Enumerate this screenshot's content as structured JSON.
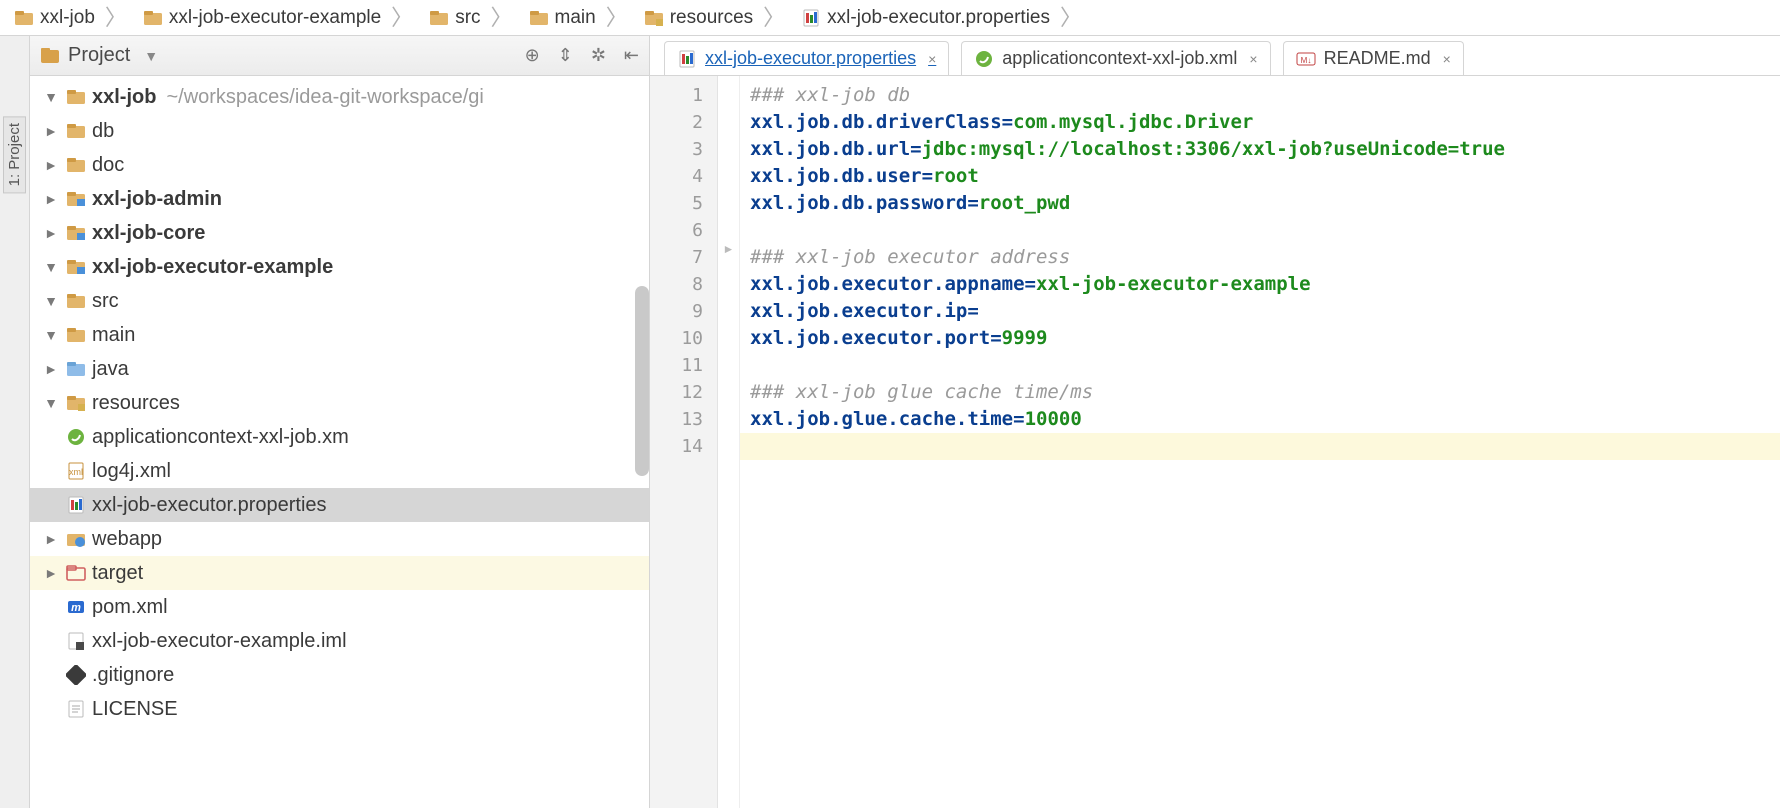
{
  "breadcrumbs": [
    {
      "label": "xxl-job",
      "icon": "folder"
    },
    {
      "label": "xxl-job-executor-example",
      "icon": "folder"
    },
    {
      "label": "src",
      "icon": "folder"
    },
    {
      "label": "main",
      "icon": "folder"
    },
    {
      "label": "resources",
      "icon": "res-folder"
    },
    {
      "label": "xxl-job-executor.properties",
      "icon": "props"
    }
  ],
  "vertical_tab": {
    "label": "1: Project"
  },
  "project_panel": {
    "title": "Project",
    "tree": [
      {
        "indent": 0,
        "arrow": "open",
        "icon": "folder",
        "label": "xxl-job",
        "bold": true,
        "hint": "~/workspaces/idea-git-workspace/gi"
      },
      {
        "indent": 1,
        "arrow": "closed",
        "icon": "folder",
        "label": "db"
      },
      {
        "indent": 1,
        "arrow": "closed",
        "icon": "folder",
        "label": "doc"
      },
      {
        "indent": 1,
        "arrow": "closed",
        "icon": "mod-folder",
        "label": "xxl-job-admin",
        "bold": true
      },
      {
        "indent": 1,
        "arrow": "closed",
        "icon": "mod-folder",
        "label": "xxl-job-core",
        "bold": true
      },
      {
        "indent": 1,
        "arrow": "open",
        "icon": "mod-folder",
        "label": "xxl-job-executor-example",
        "bold": true
      },
      {
        "indent": 2,
        "arrow": "open",
        "icon": "folder",
        "label": "src"
      },
      {
        "indent": 3,
        "arrow": "open",
        "icon": "folder",
        "label": "main"
      },
      {
        "indent": 4,
        "arrow": "closed",
        "icon": "src-folder",
        "label": "java"
      },
      {
        "indent": 4,
        "arrow": "open",
        "icon": "res-folder",
        "label": "resources"
      },
      {
        "indent": 5,
        "arrow": "none",
        "icon": "spring",
        "label": "applicationcontext-xxl-job.xm"
      },
      {
        "indent": 5,
        "arrow": "none",
        "icon": "xml",
        "label": "log4j.xml"
      },
      {
        "indent": 5,
        "arrow": "none",
        "icon": "props",
        "label": "xxl-job-executor.properties",
        "selected": true
      },
      {
        "indent": 4,
        "arrow": "closed",
        "icon": "web-folder",
        "label": "webapp"
      },
      {
        "indent": 2,
        "arrow": "closed",
        "icon": "excl-folder",
        "label": "target",
        "highlight": true
      },
      {
        "indent": 2,
        "arrow": "none",
        "icon": "maven",
        "label": "pom.xml"
      },
      {
        "indent": 2,
        "arrow": "none",
        "icon": "iml",
        "label": "xxl-job-executor-example.iml"
      },
      {
        "indent": 1,
        "arrow": "none",
        "icon": "git",
        "label": ".gitignore"
      },
      {
        "indent": 1,
        "arrow": "none",
        "icon": "text",
        "label": "LICENSE"
      }
    ]
  },
  "editor_tabs": [
    {
      "label": "xxl-job-executor.properties",
      "icon": "props",
      "active": true,
      "close": "×"
    },
    {
      "label": "applicationcontext-xxl-job.xml",
      "icon": "spring",
      "active": false,
      "close": "×"
    },
    {
      "label": "README.md",
      "icon": "md",
      "active": false,
      "close": "×"
    }
  ],
  "code_lines": [
    {
      "n": 1,
      "segments": [
        {
          "t": "### xxl-job db",
          "c": "comment"
        }
      ]
    },
    {
      "n": 2,
      "segments": [
        {
          "t": "xxl.job.db.driverClass",
          "c": "key"
        },
        {
          "t": "=",
          "c": "eq"
        },
        {
          "t": "com.mysql.jdbc.Driver",
          "c": "val"
        }
      ]
    },
    {
      "n": 3,
      "segments": [
        {
          "t": "xxl.job.db.url",
          "c": "key"
        },
        {
          "t": "=",
          "c": "eq"
        },
        {
          "t": "jdbc:mysql://localhost:3306/xxl-job?useUnicode=true",
          "c": "val"
        }
      ]
    },
    {
      "n": 4,
      "segments": [
        {
          "t": "xxl.job.db.user",
          "c": "key"
        },
        {
          "t": "=",
          "c": "eq"
        },
        {
          "t": "root",
          "c": "val"
        }
      ]
    },
    {
      "n": 5,
      "segments": [
        {
          "t": "xxl.job.db.password",
          "c": "key"
        },
        {
          "t": "=",
          "c": "eq"
        },
        {
          "t": "root_pwd",
          "c": "val"
        }
      ]
    },
    {
      "n": 6,
      "segments": []
    },
    {
      "n": 7,
      "segments": [
        {
          "t": "### xxl-job executor address",
          "c": "comment"
        }
      ]
    },
    {
      "n": 8,
      "segments": [
        {
          "t": "xxl.job.executor.appname",
          "c": "key"
        },
        {
          "t": "=",
          "c": "eq"
        },
        {
          "t": "xxl-job-executor-example",
          "c": "val"
        }
      ]
    },
    {
      "n": 9,
      "segments": [
        {
          "t": "xxl.job.executor.ip",
          "c": "key"
        },
        {
          "t": "=",
          "c": "eq"
        }
      ]
    },
    {
      "n": 10,
      "segments": [
        {
          "t": "xxl.job.executor.port",
          "c": "key"
        },
        {
          "t": "=",
          "c": "eq"
        },
        {
          "t": "9999",
          "c": "val"
        }
      ]
    },
    {
      "n": 11,
      "segments": []
    },
    {
      "n": 12,
      "segments": [
        {
          "t": "### xxl-job glue cache time/ms",
          "c": "comment"
        }
      ]
    },
    {
      "n": 13,
      "segments": [
        {
          "t": "xxl.job.glue.cache.time",
          "c": "key"
        },
        {
          "t": "=",
          "c": "eq"
        },
        {
          "t": "10000",
          "c": "val"
        }
      ]
    },
    {
      "n": 14,
      "segments": [],
      "cursor": true
    }
  ],
  "colors": {
    "key": "#0a3e8f",
    "value": "#1d8a1d",
    "comment": "#9a9a9a"
  }
}
